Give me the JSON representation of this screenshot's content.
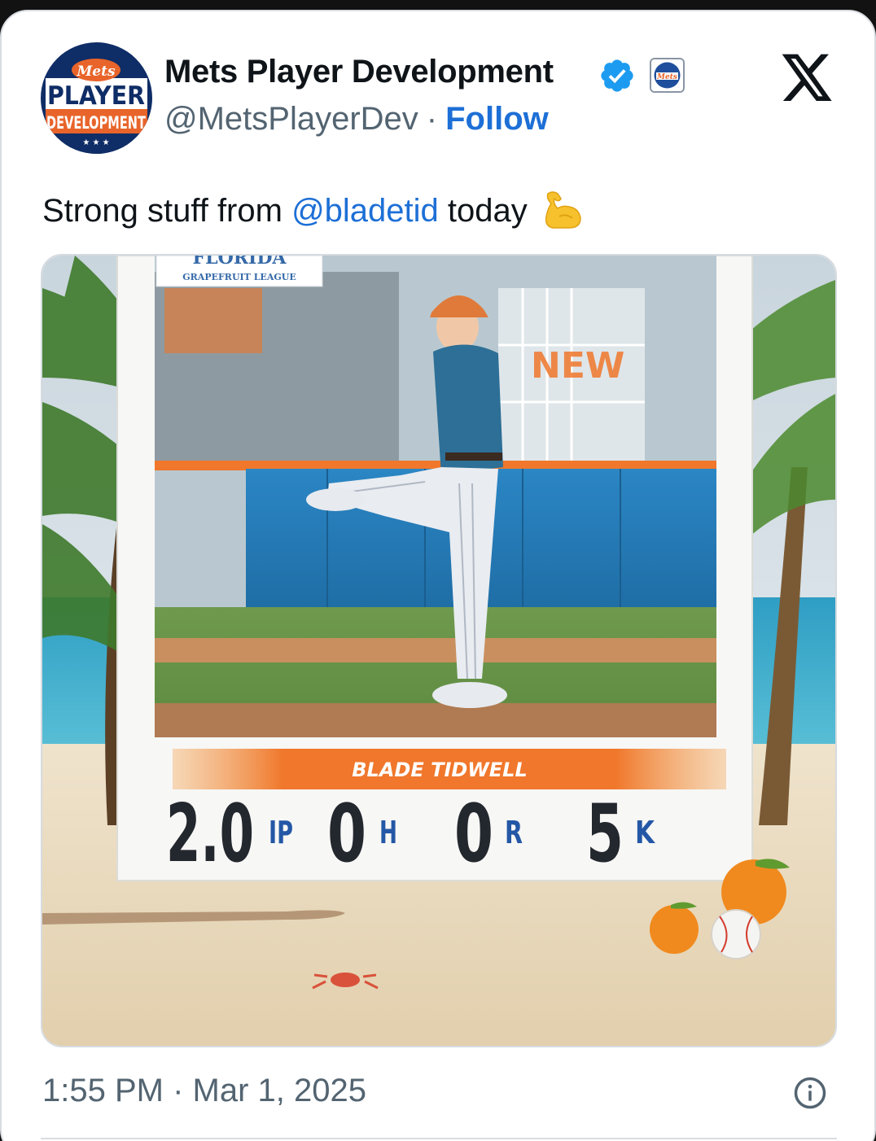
{
  "tweet": {
    "author": {
      "name": "Mets Player Development",
      "handle": "@MetsPlayerDev",
      "separator": "·",
      "follow_label": "Follow",
      "avatar_icon": "mets-player-development-logo",
      "avatar_text": {
        "top": "Mets",
        "middle": "PLAYER",
        "bottom": "DEVELOPMENT"
      },
      "verified_icon": "verified-badge-icon",
      "affiliate_badge_icon": "mets-affiliate-badge-icon"
    },
    "brand_icon": "x-logo-icon",
    "text_before": "Strong stuff from ",
    "mention": "@bladetid",
    "text_after": " today",
    "emoji_icon": "flexed-biceps-emoji",
    "timestamp": "1:55 PM · Mar 1, 2025",
    "info_icon": "info-icon"
  },
  "graphic": {
    "league_top": "FLORIDA",
    "league_sub": "GRAPEFRUIT LEAGUE",
    "player_name": "BLADE TIDWELL",
    "jersey_text": "NEW",
    "stats": [
      {
        "value": "2.0",
        "label": "IP"
      },
      {
        "value": "0",
        "label": "H"
      },
      {
        "value": "0",
        "label": "R"
      },
      {
        "value": "5",
        "label": "K"
      }
    ]
  },
  "colors": {
    "link": "#1d6fd6",
    "verified": "#1d9bf0",
    "text": "#0f1419",
    "muted": "#536471",
    "mets_orange": "#f0772b",
    "mets_blue": "#1f5fa4"
  }
}
